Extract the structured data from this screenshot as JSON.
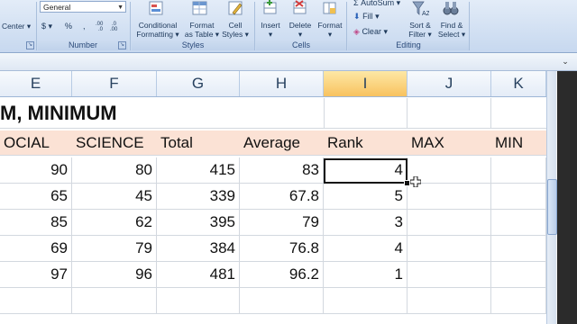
{
  "ribbon": {
    "number_format": "General",
    "alignment_fragment": "Center",
    "number_symbols": [
      "$",
      "%",
      ","
    ],
    "decimal_buttons": [
      ".00→.0",
      ".0→.00"
    ],
    "groups": {
      "number": "Number",
      "styles": "Styles",
      "cells": "Cells",
      "editing": "Editing"
    },
    "styles_buttons": [
      {
        "line1": "Conditional",
        "line2": "Formatting"
      },
      {
        "line1": "Format",
        "line2": "as Table"
      },
      {
        "line1": "Cell",
        "line2": "Styles"
      }
    ],
    "cells_buttons": [
      {
        "label": "Insert"
      },
      {
        "label": "Delete"
      },
      {
        "label": "Format"
      }
    ],
    "editing": {
      "autosum": "AutoSum",
      "fill": "Fill",
      "clear": "Clear",
      "sort_filter": {
        "line1": "Sort &",
        "line2": "Filter"
      },
      "find_select": {
        "line1": "Find &",
        "line2": "Select"
      }
    }
  },
  "grid": {
    "columns": [
      "E",
      "F",
      "G",
      "H",
      "I",
      "J",
      "K"
    ],
    "selected_column": "I",
    "title": "M, MINIMUM",
    "headers": [
      "OCIAL",
      "SCIENCE",
      "Total",
      "Average",
      "Rank",
      "MAX",
      "MIN"
    ],
    "rows": [
      {
        "social": "90",
        "science": "80",
        "total": "415",
        "average": "83",
        "rank": "4"
      },
      {
        "social": "65",
        "science": "45",
        "total": "339",
        "average": "67.8",
        "rank": "5"
      },
      {
        "social": "85",
        "science": "62",
        "total": "395",
        "average": "79",
        "rank": "3"
      },
      {
        "social": "69",
        "science": "79",
        "total": "384",
        "average": "76.8",
        "rank": "4"
      },
      {
        "social": "97",
        "science": "96",
        "total": "481",
        "average": "96.2",
        "rank": "1"
      }
    ],
    "colors": {
      "header_fill": "#fbe2d5",
      "selected_column_header": "#f8c25f"
    }
  }
}
